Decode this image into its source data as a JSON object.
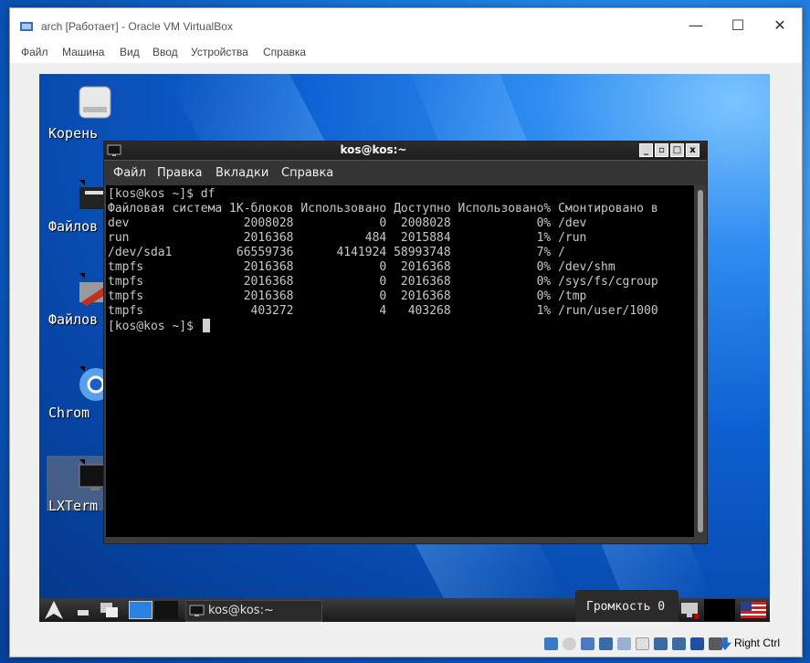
{
  "window": {
    "title": "arch [Работает] - Oracle VM VirtualBox",
    "controls": {
      "minimize": "—",
      "maximize": "☐",
      "close": "✕"
    }
  },
  "menubar": [
    "Файл",
    "Машина",
    "Вид",
    "Ввод",
    "Устройства",
    "Справка"
  ],
  "desktop": {
    "icons": [
      {
        "label": "Корень",
        "icon": "drive-icon"
      },
      {
        "label": "Файлов",
        "icon": "file-manager-icon"
      },
      {
        "label": "Файлов",
        "icon": "file-manager-root-icon"
      },
      {
        "label": "Chrom",
        "icon": "chromium-icon"
      },
      {
        "label": "LXTerm",
        "icon": "terminal-icon"
      }
    ]
  },
  "terminal": {
    "title": "kos@kos:~",
    "menu": [
      "Файл",
      "Правка",
      "Вкладки",
      "Справка"
    ],
    "controls": {
      "minimize": "_",
      "restore": "▫",
      "maximize": "□",
      "close": "x"
    },
    "lines": [
      "[kos@kos ~]$ df",
      "Файловая система 1K-блоков Использовано Доступно Использовано% Смонтировано в",
      "dev                2008028            0  2008028            0% /dev",
      "run                2016368          484  2015884            1% /run",
      "/dev/sda1         66559736      4141924 58993748            7% /",
      "tmpfs              2016368            0  2016368            0% /dev/shm",
      "tmpfs              2016368            0  2016368            0% /sys/fs/cgroup",
      "tmpfs              2016368            0  2016368            0% /tmp",
      "tmpfs               403272            4   403268            1% /run/user/1000"
    ],
    "prompt": "[kos@kos ~]$ "
  },
  "panel": {
    "task_label": "kos@kos:~",
    "volume_tooltip": "Громкость 0"
  },
  "statusbar": {
    "host_key": "Right Ctrl"
  }
}
